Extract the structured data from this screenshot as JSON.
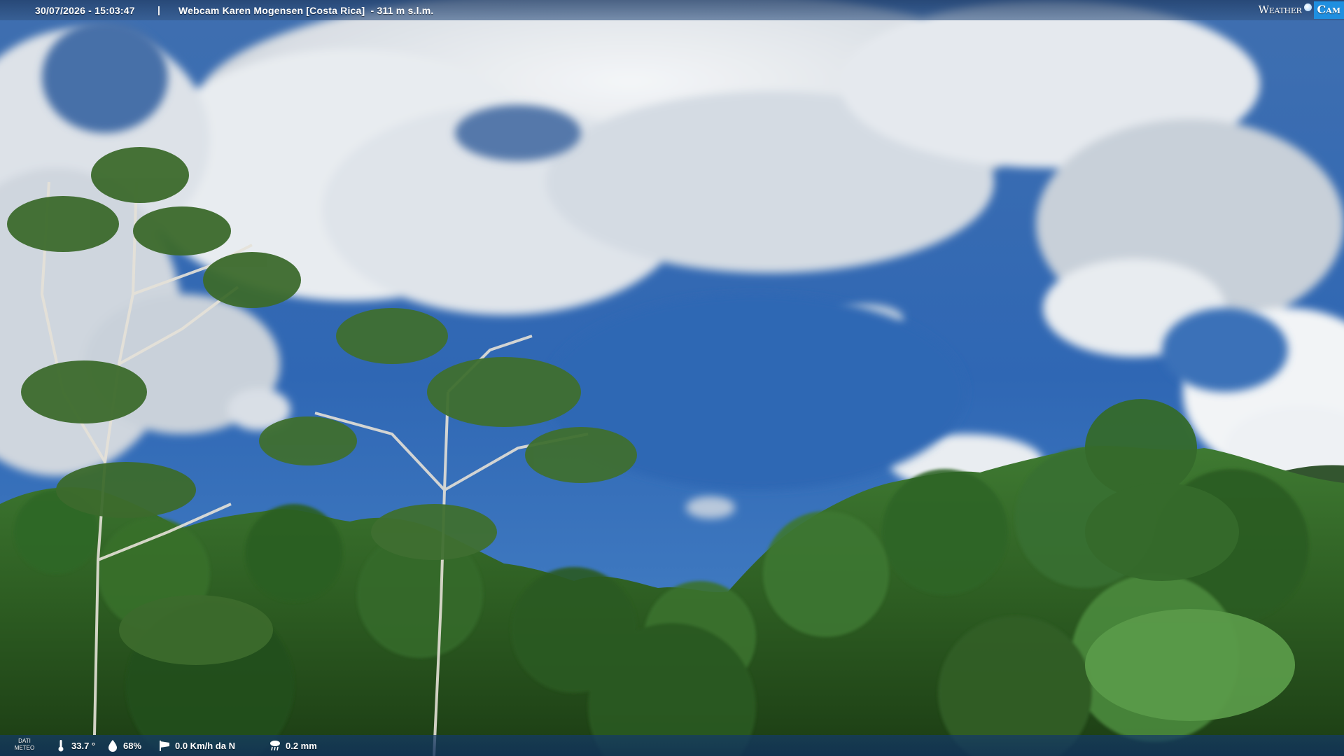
{
  "overlay": {
    "timestamp": "30/07/2026 - 15:03:47",
    "separator": "|",
    "title": "Webcam Karen Mogensen [Costa Rica]  - 311 m s.l.m.",
    "brand": {
      "weather": "Weather",
      "cam": "Cam",
      "color_accent": "#1f8fe0"
    }
  },
  "meteo": {
    "label_line1": "DATI",
    "label_line2": "METEO",
    "temperature": "33.7 °",
    "humidity": "68%",
    "wind": "0.0 Km/h da N",
    "rain": "0.2 mm",
    "icons": {
      "temperature": "thermometer-icon",
      "humidity": "droplet-icon",
      "wind": "windsock-icon",
      "rain": "rain-cloud-icon"
    }
  }
}
